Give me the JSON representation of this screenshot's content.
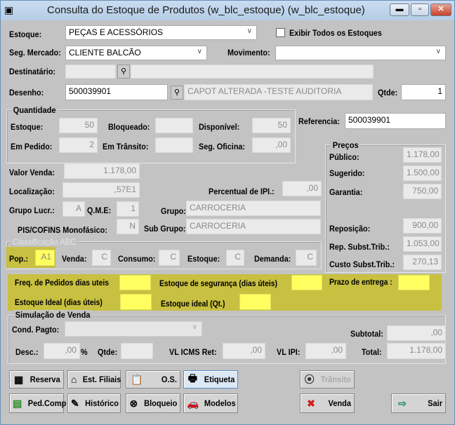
{
  "window": {
    "title": "Consulta do Estoque de Produtos (w_blc_estoque) (w_blc_estoque)",
    "controls": [
      "minimize",
      "maximize",
      "close"
    ]
  },
  "form": {
    "estoque_label": "Estoque:",
    "estoque_value": "PEÇAS E ACESSÓRIOS",
    "exibir_todos_label": "Exibir Todos os Estoques",
    "exibir_todos_checked": false,
    "seg_mercado_label": "Seg. Mercado:",
    "seg_mercado_value": "CLIENTE BALCÃO",
    "movimento_label": "Movimento:",
    "movimento_value": "",
    "destinatario_label": "Destinatário:",
    "destinatario_code": "",
    "destinatario_name": "",
    "desenho_label": "Desenho:",
    "desenho_value": "500039901",
    "desenho_desc": "CAPOT ALTERADA -TESTE AUDITORIA",
    "qtde_label": "Qtde:",
    "qtde_value": "1",
    "referencia_label": "Referencia:",
    "referencia_value": "500039901"
  },
  "quantidade": {
    "title": "Quantidade",
    "estoque_label": "Estoque:",
    "estoque": "50",
    "bloqueado_label": "Bloqueado:",
    "bloqueado": "",
    "disponivel_label": "Disponível:",
    "disponivel": "50",
    "em_pedido_label": "Em Pedido:",
    "em_pedido": "2",
    "em_transito_label": "Em Trânsito:",
    "em_transito": "",
    "seg_oficina_label": "Seg. Oficina:",
    "seg_oficina": ",00"
  },
  "info": {
    "valor_venda_label": "Valor Venda:",
    "valor_venda": "1.178,00",
    "localizacao_label": "Localização:",
    "localizacao": ",57E1",
    "ipi_label": "Percentual de IPI.:",
    "ipi": ",00",
    "grupo_lucr_label": "Grupo Lucr.:",
    "grupo_lucr": "A",
    "qme_label": "Q.M.E:",
    "qme": "1",
    "grupo_label": "Grupo:",
    "grupo": "CARROCERIA",
    "pis_label": "PIS/COFINS Monofásico:",
    "pis": "N",
    "subgrupo_label": "Sub Grupo:",
    "subgrupo": "CARROCERIA"
  },
  "precos": {
    "title": "Preços",
    "publico_label": "Público:",
    "publico": "1.178,00",
    "sugerido_label": "Sugerido:",
    "sugerido": "1.500,00",
    "garantia_label": "Garantia:",
    "garantia": "750,00",
    "reposicao_label": "Reposição:",
    "reposicao": "900,00",
    "rep_subst_label": "Rep. Subst.Trib.:",
    "rep_subst": "1.053,00",
    "custo_subst_label": "Custo Subst.Trib.:",
    "custo_subst": "270,13"
  },
  "abc": {
    "title": "Classificação ABC",
    "pop_label": "Pop.:",
    "pop": "A1",
    "venda_label": "Venda:",
    "venda": "C",
    "consumo_label": "Consumo:",
    "consumo": "C",
    "estoque_label": "Estoque:",
    "estoque": "C",
    "demanda_label": "Demanda:",
    "demanda": "C"
  },
  "ideal": {
    "freq_label": "Freq. de Pedidos dias uteis",
    "seg_label": "Estoque de segurança (dias úteis)",
    "prazo_label": "Prazo de entrega :",
    "ideal_dias_label": "Estoque Ideal (dias úteis)",
    "ideal_qt_label": "Estoque ideal (Qt.)",
    "highlight_color": "#ffff60",
    "band_color": "#c8c040"
  },
  "simulacao": {
    "title": "Simulação de Venda",
    "cond_label": "Cond. Pagto:",
    "cond": "",
    "subtotal_label": "Subtotal:",
    "subtotal": ",00",
    "desc_label": "Desc.:",
    "desc": ",00",
    "pct": "%",
    "qtde_label": "Qtde:",
    "qtde": "",
    "icms_label": "VL ICMS Ret:",
    "icms": ",00",
    "ipi_label": "VL IPI:",
    "ipi": ",00",
    "total_label": "Total:",
    "total": "1.178,00"
  },
  "buttons": {
    "reserva": "Reserva",
    "filiais": "Est. Filiais",
    "os": "O.S.",
    "etiqueta": "Etiqueta",
    "transito": "Trânsito",
    "pedcomp": "Ped.Comp",
    "historico": "Histórico",
    "bloqueio": "Bloqueio",
    "modelos": "Modelos",
    "venda": "Venda",
    "sair": "Sair"
  }
}
